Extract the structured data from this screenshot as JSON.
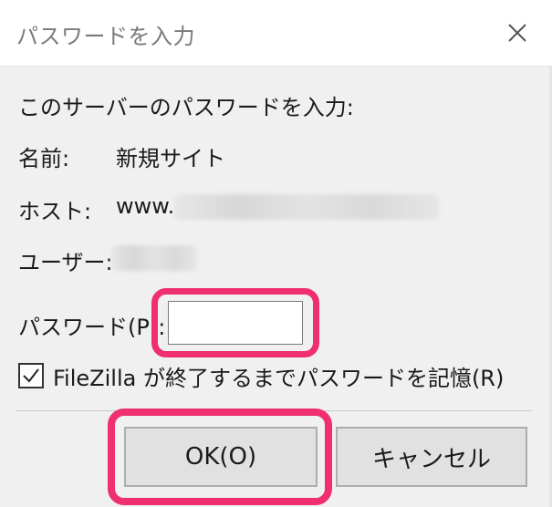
{
  "window": {
    "title": "パスワードを入力",
    "close_icon": "close-icon"
  },
  "prompt": "このサーバーのパスワードを入力:",
  "fields": {
    "name_label": "名前:",
    "name_value": "新規サイト",
    "host_label": "ホスト:",
    "host_value_prefix": "www.",
    "user_label": "ユーザー:"
  },
  "password": {
    "label": "パスワード(P):",
    "value": "",
    "placeholder": ""
  },
  "remember": {
    "checked": true,
    "label": "FileZilla が終了するまでパスワードを記憶(R)"
  },
  "buttons": {
    "ok": "OK(O)",
    "cancel": "キャンセル"
  },
  "colors": {
    "highlight": "#ef2f72",
    "dialog_bg": "#f0f0f0",
    "titlebar_bg": "#ffffff",
    "button_bg": "#e1e1e1"
  }
}
